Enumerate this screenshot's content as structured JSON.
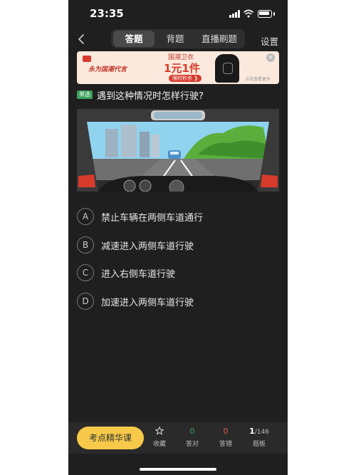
{
  "status_bar": {
    "time": "23:35"
  },
  "nav": {
    "tabs": [
      {
        "label": "答题",
        "active": true
      },
      {
        "label": "背题",
        "active": false
      },
      {
        "label": "直播刷题",
        "active": false
      }
    ],
    "settings_label": "设置"
  },
  "ad": {
    "brand": "永为国潮代言",
    "title": "国潮卫衣",
    "price": "1元1件",
    "button": "限时秒杀 ❯",
    "note": "点击查看更多"
  },
  "question": {
    "type_badge": "单选",
    "text": "遇到这种情况时怎样行驶?"
  },
  "options": [
    {
      "letter": "A",
      "text": "禁止车辆在两侧车道通行"
    },
    {
      "letter": "B",
      "text": "减速进入两侧车道行驶"
    },
    {
      "letter": "C",
      "text": "进入右侧车道行驶"
    },
    {
      "letter": "D",
      "text": "加速进入两侧车道行驶"
    }
  ],
  "bottom_bar": {
    "cta_label": "考点精华课",
    "collect_label": "收藏",
    "correct_count": "0",
    "correct_label": "答对",
    "wrong_count": "0",
    "wrong_label": "答错",
    "progress_current": "1",
    "progress_total": "/146",
    "board_label": "题板"
  },
  "colors": {
    "background": "#1f1f1f",
    "accent": "#f6c94a",
    "correct": "#3aa05a",
    "wrong": "#e05a4a",
    "badge": "#3aa05a"
  }
}
